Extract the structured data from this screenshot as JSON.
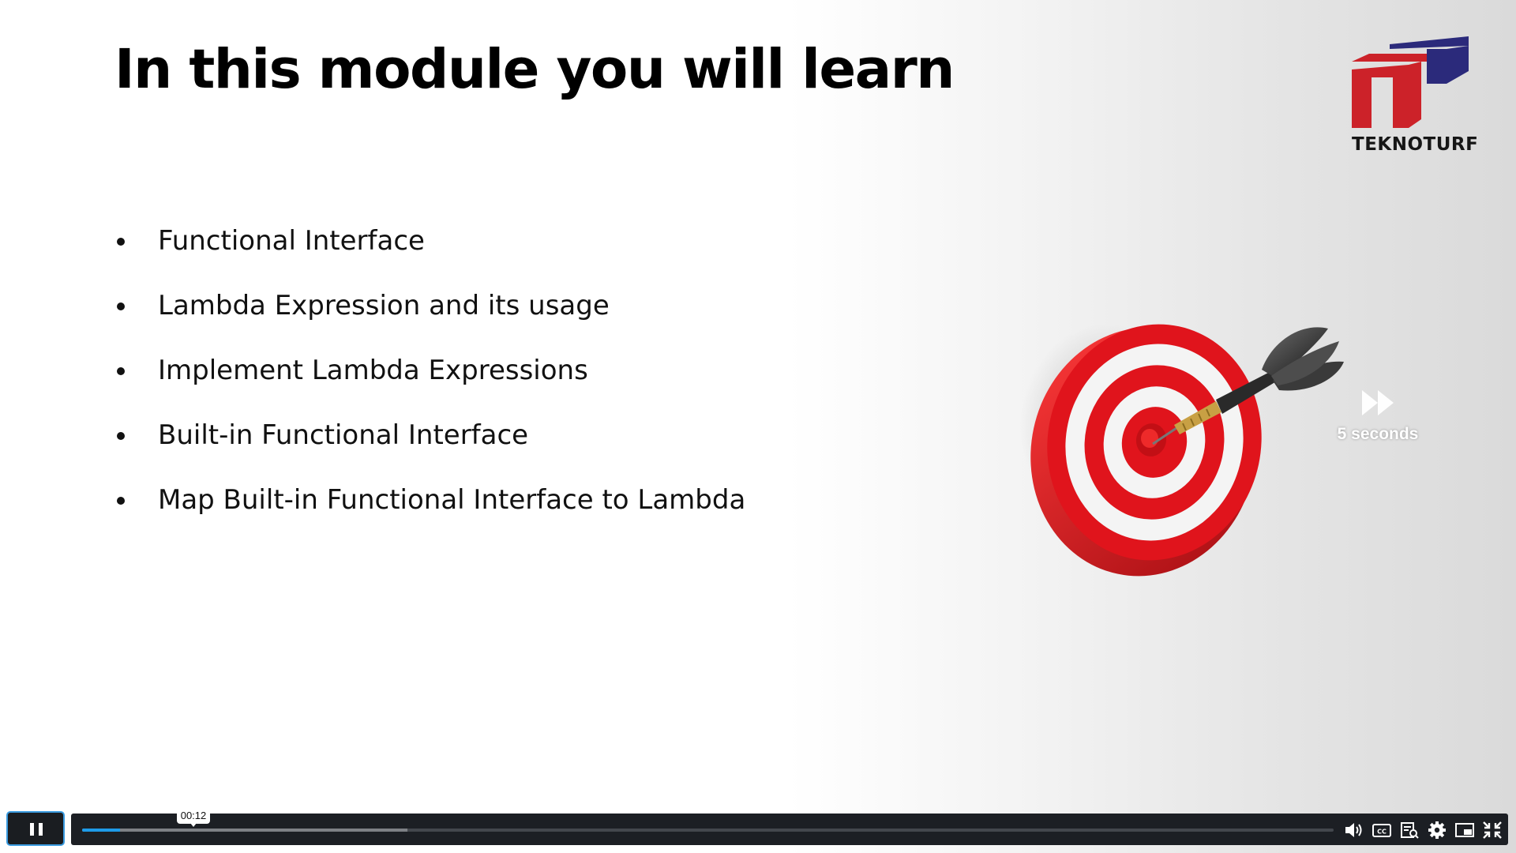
{
  "slide": {
    "title": "In this module you will learn",
    "bullets": [
      "Functional Interface",
      "Lambda Expression and its usage",
      "Implement Lambda Expressions",
      "Built-in Functional Interface",
      "Map Built-in Functional Interface to Lambda"
    ],
    "logo_text": "TEKNOTURF",
    "image": "dart-hitting-bullseye-target"
  },
  "skip_overlay": {
    "icon": "fast-forward-icon",
    "label": "5 seconds"
  },
  "player": {
    "state": "playing",
    "hover_time": "00:12",
    "played_fraction": 0.03,
    "buffered_fraction": 0.26,
    "controls": [
      {
        "name": "pause-button",
        "icon": "pause-icon"
      },
      {
        "name": "volume-button",
        "icon": "volume-icon"
      },
      {
        "name": "captions-button",
        "icon": "closed-captions-icon"
      },
      {
        "name": "transcript-button",
        "icon": "transcript-icon"
      },
      {
        "name": "settings-button",
        "icon": "gear-icon"
      },
      {
        "name": "picture-in-picture-button",
        "icon": "picture-in-picture-icon"
      },
      {
        "name": "exit-fullscreen-button",
        "icon": "exit-fullscreen-icon"
      }
    ]
  },
  "colors": {
    "accent": "#1e9be9",
    "logo_red": "#cc2229",
    "logo_navy": "#2b2a7b",
    "target_red": "#e0141c"
  }
}
